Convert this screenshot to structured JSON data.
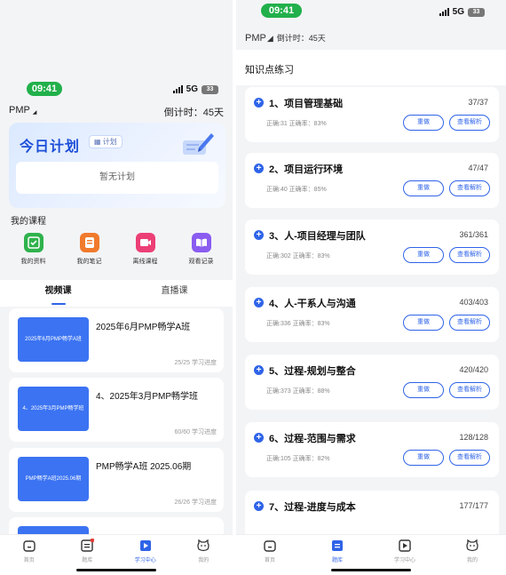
{
  "left": {
    "status": {
      "time": "09:41",
      "network": "5G",
      "battery": "33"
    },
    "header": {
      "exam": "PMP",
      "countdown": "倒计时：45天"
    },
    "plan": {
      "title": "今日计划",
      "tag": "计划",
      "empty": "暂无计划"
    },
    "courses_title": "我的课程",
    "shortcuts": [
      {
        "label": "我的资料",
        "icon": "check-icon",
        "color": "#2fb24c"
      },
      {
        "label": "我的笔记",
        "icon": "notes-icon",
        "color": "#f07a2c"
      },
      {
        "label": "离线课程",
        "icon": "video-icon",
        "color": "#ec3f76"
      },
      {
        "label": "观看记录",
        "icon": "book-icon",
        "color": "#8a5cf0"
      }
    ],
    "tabs": [
      "视频课",
      "直播课"
    ],
    "course_cards": [
      {
        "cover": "2025年6月PMP畅学A班",
        "name": "2025年6月PMP畅学A班",
        "progress": "25/25 学习进度"
      },
      {
        "cover": "4、2025年3月PMP畅学班",
        "name": "4、2025年3月PMP畅学班",
        "progress": "60/60 学习进度"
      },
      {
        "cover": "PMP畅学A班2025.06期",
        "name": "PMP畅学A班 2025.06期",
        "progress": "26/26 学习进度"
      }
    ],
    "nav": [
      {
        "label": "首页",
        "icon": "home-icon"
      },
      {
        "label": "题库",
        "icon": "question-bank-icon"
      },
      {
        "label": "学习中心",
        "icon": "study-center-icon"
      },
      {
        "label": "我的",
        "icon": "profile-icon"
      }
    ]
  },
  "right": {
    "status": {
      "time": "09:41",
      "network": "5G",
      "battery": "33"
    },
    "header": {
      "exam": "PMP",
      "countdown": "倒计时：45天"
    },
    "section_title": "知识点练习",
    "redo_label": "重做",
    "view_label": "查看解析",
    "topics": [
      {
        "name": "1、项目管理基础",
        "count": "37/37",
        "stats": "正确:31  正确率：83%"
      },
      {
        "name": "2、项目运行环境",
        "count": "47/47",
        "stats": "正确:40  正确率：85%"
      },
      {
        "name": "3、人-项目经理与团队",
        "count": "361/361",
        "stats": "正确:302  正确率：83%"
      },
      {
        "name": "4、人-干系人与沟通",
        "count": "403/403",
        "stats": "正确:336  正确率：83%"
      },
      {
        "name": "5、过程-规划与整合",
        "count": "420/420",
        "stats": "正确:373  正确率：88%"
      },
      {
        "name": "6、过程-范围与需求",
        "count": "128/128",
        "stats": "正确:105  正确率：82%"
      },
      {
        "name": "7、过程-进度与成本",
        "count": "177/177",
        "stats": ""
      }
    ],
    "nav": [
      {
        "label": "首页",
        "icon": "home-icon"
      },
      {
        "label": "题库",
        "icon": "question-bank-icon"
      },
      {
        "label": "学习中心",
        "icon": "study-center-icon"
      },
      {
        "label": "我的",
        "icon": "profile-icon"
      }
    ]
  }
}
